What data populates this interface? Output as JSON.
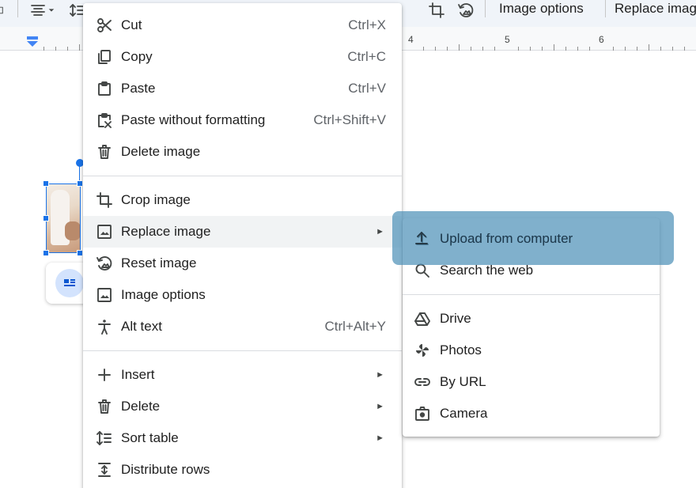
{
  "toolbar": {
    "image_options_label": "Image options",
    "replace_image_label": "Replace imag"
  },
  "ruler": {
    "numbers": [
      "4",
      "5",
      "6"
    ]
  },
  "context_menu": {
    "cut": {
      "label": "Cut",
      "shortcut": "Ctrl+X",
      "icon": "scissors-icon"
    },
    "copy": {
      "label": "Copy",
      "shortcut": "Ctrl+C",
      "icon": "copy-icon"
    },
    "paste": {
      "label": "Paste",
      "shortcut": "Ctrl+V",
      "icon": "clipboard-icon"
    },
    "paste_plain": {
      "label": "Paste without formatting",
      "shortcut": "Ctrl+Shift+V",
      "icon": "clipboard-format-icon"
    },
    "delete_image": {
      "label": "Delete image",
      "icon": "trash-icon"
    },
    "crop_image": {
      "label": "Crop image",
      "icon": "crop-icon"
    },
    "replace_image": {
      "label": "Replace image",
      "icon": "image-icon",
      "has_submenu": true
    },
    "reset_image": {
      "label": "Reset image",
      "icon": "reset-image-icon"
    },
    "image_options": {
      "label": "Image options",
      "icon": "image-icon"
    },
    "alt_text": {
      "label": "Alt text",
      "shortcut": "Ctrl+Alt+Y",
      "icon": "accessibility-icon"
    },
    "insert": {
      "label": "Insert",
      "icon": "plus-icon",
      "has_submenu": true
    },
    "delete": {
      "label": "Delete",
      "icon": "trash-icon",
      "has_submenu": true
    },
    "sort_table": {
      "label": "Sort table",
      "icon": "sort-icon",
      "has_submenu": true
    },
    "distribute_rows": {
      "label": "Distribute rows",
      "icon": "distribute-rows-icon"
    }
  },
  "submenu": {
    "upload": {
      "label": "Upload from computer",
      "icon": "upload-icon"
    },
    "search_web": {
      "label": "Search the web",
      "icon": "search-icon"
    },
    "drive": {
      "label": "Drive",
      "icon": "drive-icon"
    },
    "photos": {
      "label": "Photos",
      "icon": "photos-pinwheel-icon"
    },
    "by_url": {
      "label": "By URL",
      "icon": "link-icon"
    },
    "camera": {
      "label": "Camera",
      "icon": "camera-icon"
    }
  },
  "colors": {
    "accent": "#1a73e8",
    "highlight": "#4f92b8",
    "hover_row": "#f1f3f4",
    "toolbar_bg": "#f0f4f9"
  }
}
